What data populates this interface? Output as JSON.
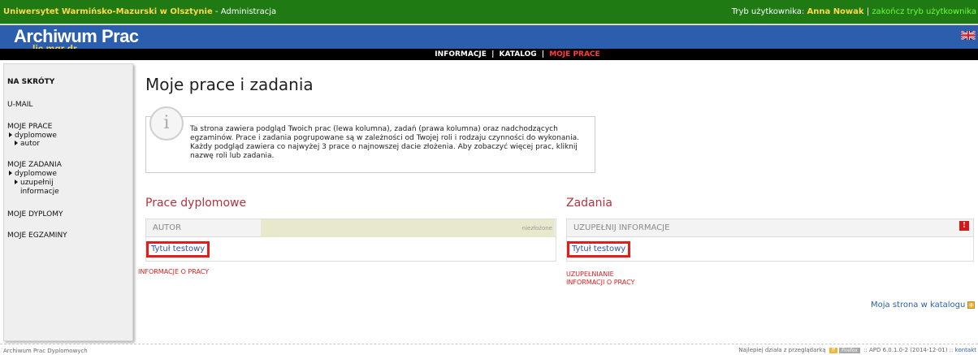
{
  "topbar": {
    "university": "Uniwersytet Warmińsko-Mazurski w Olsztynie",
    "section": " - Administracja",
    "mode_label": "Tryb użytkownika: ",
    "user": "Anna Nowak",
    "separator": " | ",
    "end_mode": "zakończ tryb użytkownika"
  },
  "header": {
    "brand": "Archiwum Prac",
    "subbrand": "lic mgr dr"
  },
  "nav": {
    "items": [
      "INFORMACJE",
      "KATALOG",
      "MOJE PRACE"
    ],
    "sep": "|"
  },
  "sidebar": {
    "shortcuts": "NA SKRÓTY",
    "umail": "U-MAIL",
    "my_works": "MOJE PRACE",
    "my_works_sub1": "dyplomowe",
    "my_works_sub2": "autor",
    "my_tasks": "MOJE ZADANIA",
    "my_tasks_sub1": "dyplomowe",
    "my_tasks_sub2": "uzupełnij",
    "my_tasks_sub3": "informacje",
    "my_diplomas": "MOJE DYPLOMY",
    "my_exams": "MOJE EGZAMINY"
  },
  "main": {
    "title": "Moje prace i zadania",
    "info_text": "Ta strona zawiera podgląd Twoich prac (lewa kolumna), zadań (prawa kolumna) oraz nadchodzących egzaminów. Prace i zadania pogrupowane są w zależności od Twojej roli i rodzaju czynności do wykonania. Każdy podgląd zawiera co najwyżej 3 prace o najnowszej dacie złożenia. Aby zobaczyć więcej prac, kliknij nazwę roli lub zadania."
  },
  "left": {
    "title": "Prace dyplomowe",
    "header": "AUTOR",
    "status": "niezłożone",
    "item": "Tytuł testowy",
    "link": "INFORMACJE O PRACY"
  },
  "right": {
    "title": "Zadania",
    "header": "UZUPEŁNIJ INFORMACJE",
    "alert": "!",
    "item": "Tytuł testowy",
    "link1": "UZUPEŁNIANIE",
    "link2": "INFORMACJI O PRACY",
    "catalog": "Moja strona w katalogu"
  },
  "footer": {
    "left": "Archiwum Prac Dyplomowych",
    "right_prefix": "Najlepiej działa z przeglądarką",
    "badge2": "Firefox",
    "right_suffix": ":: APD 6.0.1.0-2 (2014-12-01) ::",
    "contact": "kontakt"
  }
}
